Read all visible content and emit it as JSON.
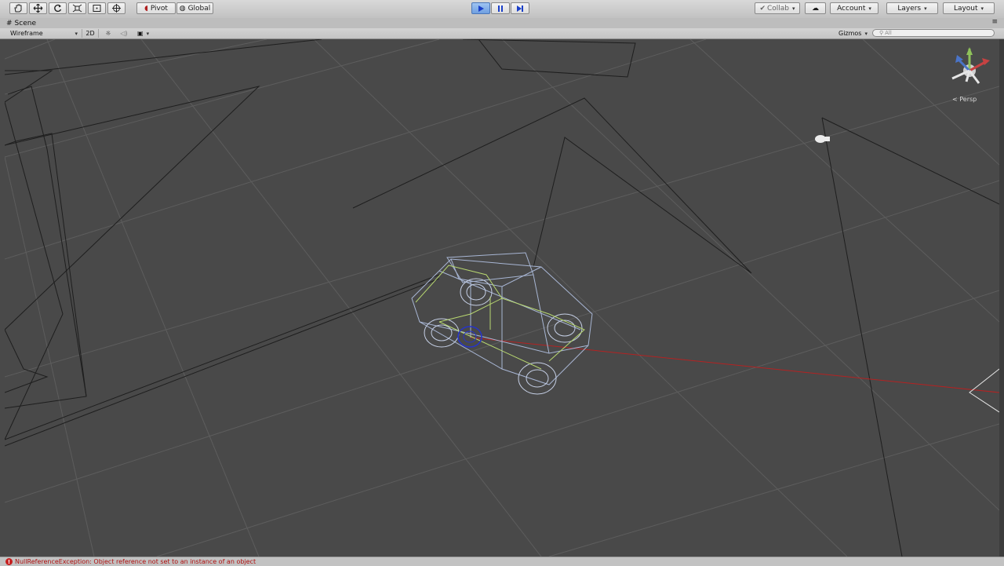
{
  "toolbar": {
    "tools": [
      "hand-icon",
      "move-icon",
      "rotate-icon",
      "scale-icon",
      "rect-tool-icon",
      "transform-tool-icon"
    ],
    "pivot_label": "Pivot",
    "global_label": "Global",
    "collab_label": "Collab",
    "account_label": "Account",
    "layers_label": "Layers",
    "layout_label": "Layout",
    "play_active": true,
    "accent_color": "#6f9fe0"
  },
  "scene": {
    "tab_label": "Scene",
    "draw_mode": "Wireframe",
    "mode_2d": "2D",
    "gizmos_label": "Gizmos",
    "search_placeholder": "All",
    "projection_label": "Persp"
  },
  "status": {
    "message": "NullReferenceException: Object reference not set to an instance of an object",
    "error_color": "#c62020"
  }
}
